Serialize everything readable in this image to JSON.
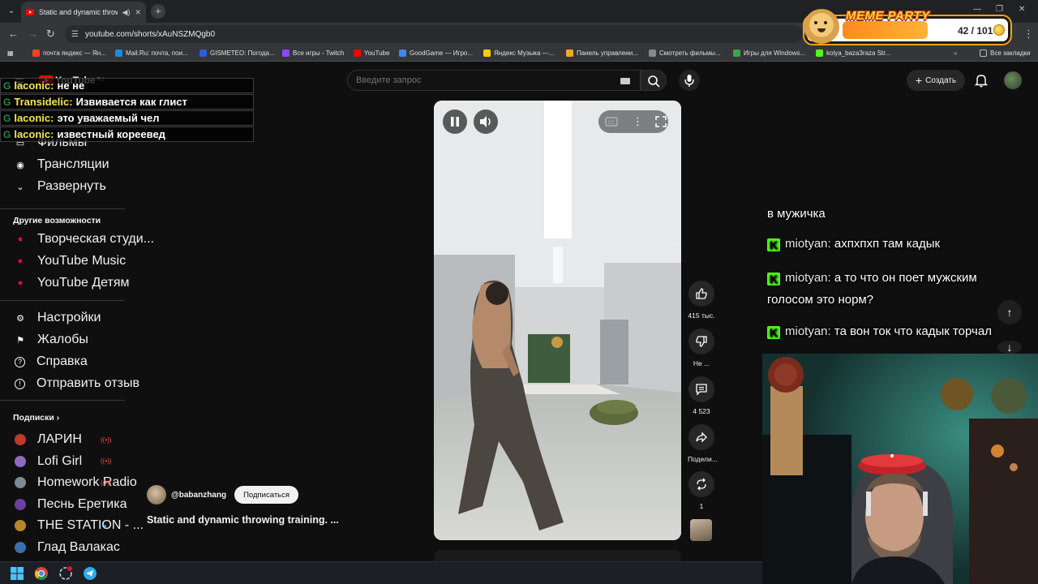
{
  "browser": {
    "tab_title": "Static and dynamic throwing",
    "url": "youtube.com/shorts/xAuNSZMQgb0",
    "bookmarks": [
      {
        "label": "почта яндекс — Ян...",
        "color": "#fc3f1d"
      },
      {
        "label": "Mail.Ru: почта, пои...",
        "color": "#168de2"
      },
      {
        "label": "GISMETEO: Погода...",
        "color": "#2b5fd9"
      },
      {
        "label": "Все игры - Twitch",
        "color": "#9146ff"
      },
      {
        "label": "YouTube",
        "color": "#ff0000"
      },
      {
        "label": "GoodGame — Игро...",
        "color": "#4285f4"
      },
      {
        "label": "Яндекс Музыка —...",
        "color": "#ffcc00"
      },
      {
        "label": "Панель управлени...",
        "color": "#f5a623"
      },
      {
        "label": "Смотреть фильмы...",
        "color": "#888888"
      },
      {
        "label": "Игры для Windows...",
        "color": "#3fa34d"
      },
      {
        "label": "kolya_baza3raza Str...",
        "color": "#53fc18"
      }
    ],
    "all_bookmarks": "Все закладки"
  },
  "youtube": {
    "logo": "YouTube",
    "region": "RU",
    "search_placeholder": "Введите запрос",
    "create_label": "Создать",
    "sidebar": {
      "top_items": [
        {
          "label": "Фильмы",
          "icon": "film-icon"
        },
        {
          "label": "Трансляции",
          "icon": "live-icon"
        },
        {
          "label": "Развернуть",
          "icon": "chevron-down-icon"
        }
      ],
      "more_heading": "Другие возможности",
      "more_items": [
        {
          "label": "Творческая студи...",
          "icon": "studio-icon"
        },
        {
          "label": "YouTube Music",
          "icon": "music-icon"
        },
        {
          "label": "YouTube Детям",
          "icon": "kids-icon"
        }
      ],
      "settings_items": [
        {
          "label": "Настройки",
          "icon": "gear-icon"
        },
        {
          "label": "Жалобы",
          "icon": "flag-icon"
        },
        {
          "label": "Справка",
          "icon": "help-icon"
        },
        {
          "label": "Отправить отзыв",
          "icon": "feedback-icon"
        }
      ],
      "subs_heading": "Подписки",
      "subscriptions": [
        {
          "label": "ЛАРИН",
          "status": "live",
          "color": "#c0392b"
        },
        {
          "label": "Lofi Girl",
          "status": "live",
          "color": "#8e6bbf"
        },
        {
          "label": "Homework Radio",
          "status": "live",
          "color": "#7d8a96"
        },
        {
          "label": "Песнь Еретика",
          "status": "",
          "color": "#6c3fa0"
        },
        {
          "label": "THE STATION - ...",
          "status": "new",
          "color": "#b8862b"
        },
        {
          "label": "Глад Валакас",
          "status": "",
          "color": "#3a6fb0"
        }
      ]
    },
    "short": {
      "channel": "@babanzhang",
      "subscribe_label": "Подписаться",
      "title": "Static and dynamic throwing training. ...",
      "likes": "415 тыс.",
      "dislike_label": "Не ...",
      "comments": "4 523",
      "share_label": "Подели...",
      "remix_count": "1"
    }
  },
  "chat_overlay": [
    {
      "user": "laconic:",
      "message": "не не"
    },
    {
      "user": "Transidelic:",
      "message": "Извивается как глист"
    },
    {
      "user": "laconic:",
      "message": "это уважаемый чел"
    },
    {
      "user": "laconic:",
      "message": "известный кореевед"
    }
  ],
  "right_chat": {
    "fragment": "в мужичка",
    "messages": [
      {
        "user": "miotyan:",
        "message": "ахпхпхп там кадык"
      },
      {
        "user": "miotyan:",
        "message": "а то что он поет мужским",
        "cont": "голосом это норм?"
      },
      {
        "user": "miotyan:",
        "message": "та вон ток что кадык торчал"
      }
    ]
  },
  "meme_party": {
    "title": "MEME PARTY",
    "count": "42 / 101",
    "progress": 0.42
  }
}
